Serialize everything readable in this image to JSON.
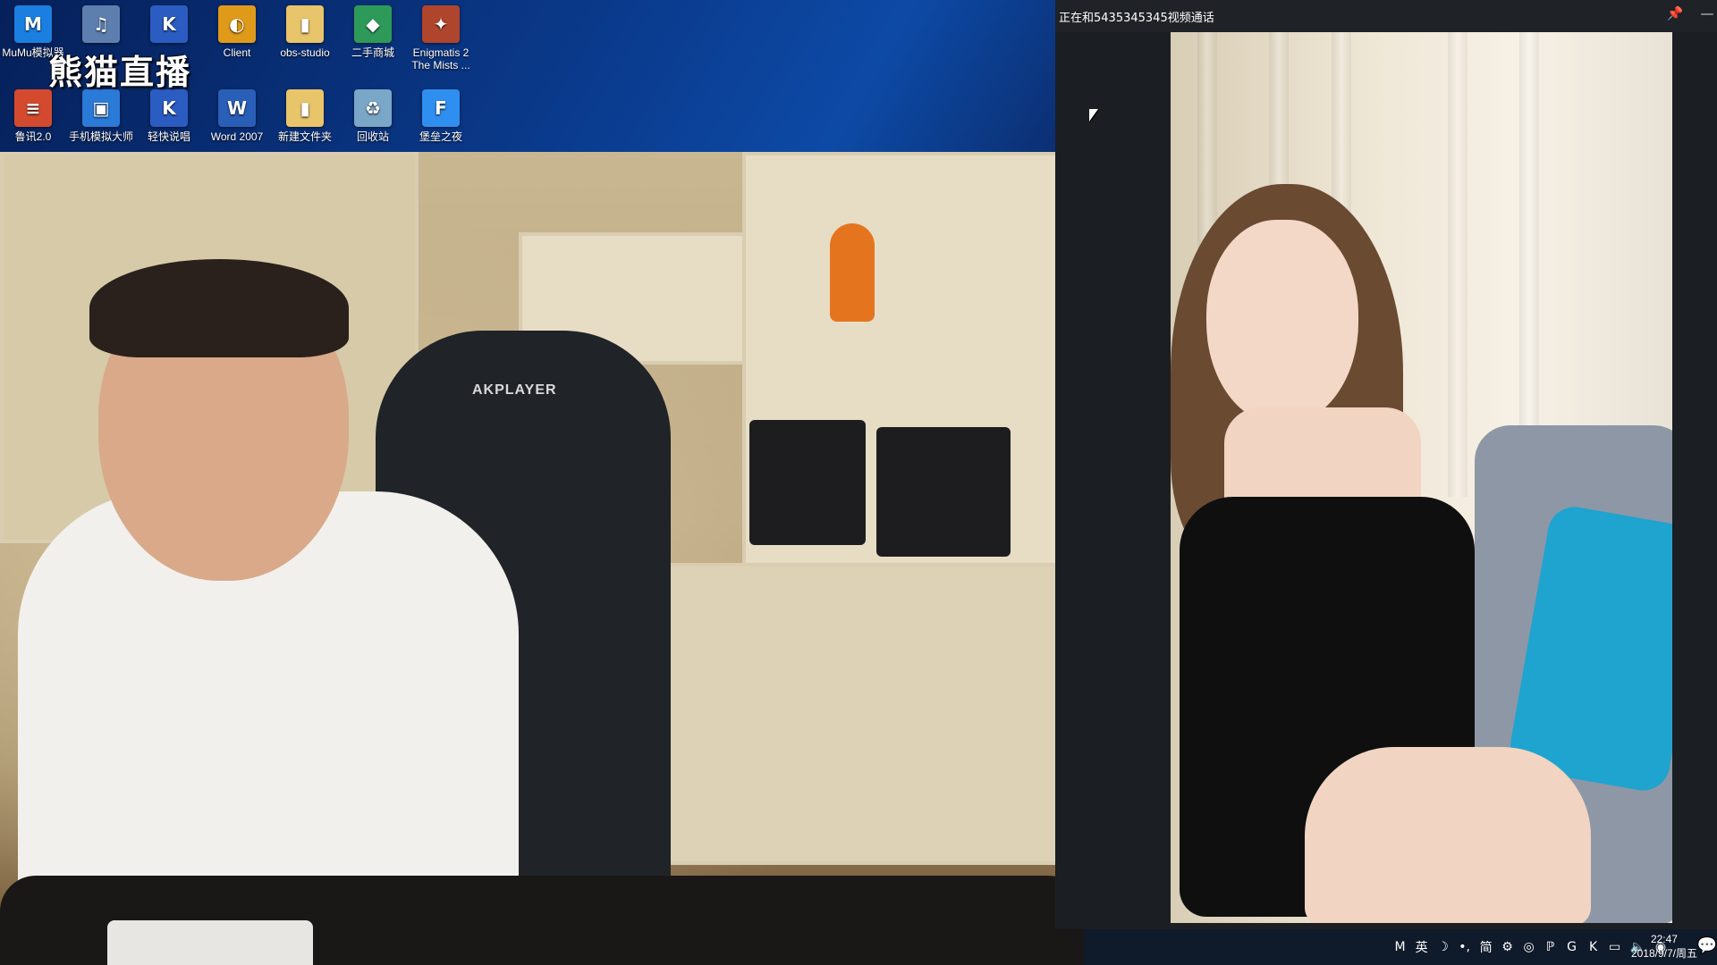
{
  "desktop": {
    "brand_text": "熊猫直播",
    "icons_row1": [
      {
        "label": "MuMu模拟器",
        "icon": "mumu-icon",
        "glyph": "M",
        "color": "#1a7fe0"
      },
      {
        "label": "",
        "icon": "mp3-file-icon",
        "glyph": "♫",
        "color": "#5c7fb0"
      },
      {
        "label": "",
        "icon": "kx-app-icon",
        "glyph": "K",
        "color": "#2b5cc2"
      },
      {
        "label": "Client",
        "icon": "client-icon",
        "glyph": "◐",
        "color": "#e09a1a"
      },
      {
        "label": "obs-studio",
        "icon": "folder-icon",
        "glyph": "▮",
        "color": "#e8c46a"
      },
      {
        "label": "二手商城",
        "icon": "store-icon",
        "glyph": "◆",
        "color": "#2e9a5a"
      },
      {
        "label": "Enigmatis 2 The Mists ...",
        "icon": "game-icon",
        "glyph": "✦",
        "color": "#b0452e"
      }
    ],
    "icons_row2": [
      {
        "label": "鲁讯2.0",
        "icon": "document-icon",
        "glyph": "≡",
        "color": "#d44a2e"
      },
      {
        "label": "手机模拟大师",
        "icon": "phone-emulator-icon",
        "glyph": "▣",
        "color": "#2a7ad8"
      },
      {
        "label": "轻快说唱",
        "icon": "kx-app-icon",
        "glyph": "K",
        "color": "#2b5cc2"
      },
      {
        "label": "Word 2007",
        "icon": "word-icon",
        "glyph": "W",
        "color": "#2a5fb8"
      },
      {
        "label": "新建文件夹",
        "icon": "folder-icon",
        "glyph": "▮",
        "color": "#e8c46a"
      },
      {
        "label": "回收站",
        "icon": "recycle-bin-icon",
        "glyph": "♻",
        "color": "#7aa6c8"
      },
      {
        "label": "堡垒之夜",
        "icon": "fortnite-icon",
        "glyph": "F",
        "color": "#2f8ff0"
      }
    ]
  },
  "left_camera": {
    "chair_brand": "AKPLAYER"
  },
  "call_window": {
    "title": "正在和5435345345视频通话",
    "pin_glyph": "📌",
    "minimize_glyph": "—"
  },
  "taskbar": {
    "tray_icons": [
      {
        "name": "input-method-m-icon",
        "glyph": "M"
      },
      {
        "name": "ime-lang-icon",
        "glyph": "英"
      },
      {
        "name": "moon-icon",
        "glyph": "☽"
      },
      {
        "name": "punctuation-icon",
        "glyph": "•,"
      },
      {
        "name": "simplified-icon",
        "glyph": "简"
      },
      {
        "name": "settings-icon",
        "glyph": "⚙"
      },
      {
        "name": "shield-icon",
        "glyph": "◎"
      },
      {
        "name": "app-tray-icon",
        "glyph": "ℙ"
      },
      {
        "name": "g-app-icon",
        "glyph": "G"
      },
      {
        "name": "kx-tray-icon",
        "glyph": "K"
      },
      {
        "name": "network-icon",
        "glyph": "▭"
      },
      {
        "name": "volume-icon",
        "glyph": "🔈"
      },
      {
        "name": "blue-app-icon",
        "glyph": "◉"
      }
    ],
    "time": "22:47",
    "date": "2018/9/7/周五",
    "notification_glyph": "💬"
  }
}
